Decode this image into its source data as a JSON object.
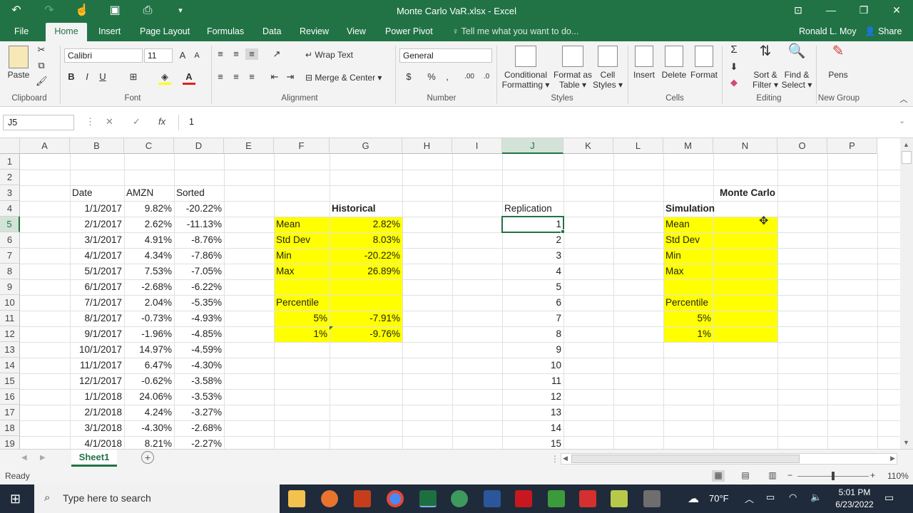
{
  "window": {
    "title": "Monte Carlo VaR.xlsx - Excel"
  },
  "tabs": [
    "File",
    "Home",
    "Insert",
    "Page Layout",
    "Formulas",
    "Data",
    "Review",
    "View",
    "Power Pivot"
  ],
  "tell_me": "Tell me what you want to do...",
  "user": "Ronald L. Moy",
  "share": "Share",
  "ribbon": {
    "paste": "Paste",
    "font_name": "Calibri",
    "font_size": "11",
    "wrap_text": "Wrap Text",
    "merge_center": "Merge & Center",
    "number_format": "General",
    "conditional_formatting": [
      "Conditional",
      "Formatting"
    ],
    "format_as_table": [
      "Format as",
      "Table"
    ],
    "cell_styles": [
      "Cell",
      "Styles"
    ],
    "insert": "Insert",
    "delete": "Delete",
    "format": "Format",
    "sort_filter": [
      "Sort &",
      "Filter"
    ],
    "find_select": [
      "Find &",
      "Select"
    ],
    "pens": "Pens",
    "groups": [
      "Clipboard",
      "Font",
      "Alignment",
      "Number",
      "Styles",
      "Cells",
      "Editing",
      "New Group"
    ]
  },
  "formula_bar": {
    "name_box": "J5",
    "value": "1"
  },
  "columns": [
    "A",
    "B",
    "C",
    "D",
    "E",
    "F",
    "G",
    "H",
    "I",
    "J",
    "K",
    "L",
    "M",
    "N",
    "O",
    "P"
  ],
  "rows": [
    "1",
    "2",
    "3",
    "4",
    "5",
    "6",
    "7",
    "8",
    "9",
    "10",
    "11",
    "12",
    "13",
    "14",
    "15",
    "16",
    "17",
    "18",
    "19"
  ],
  "data": {
    "headers": {
      "date": "Date",
      "amzn": "AMZN",
      "sorted": "Sorted"
    },
    "dates": [
      "1/1/2017",
      "2/1/2017",
      "3/1/2017",
      "4/1/2017",
      "5/1/2017",
      "6/1/2017",
      "7/1/2017",
      "8/1/2017",
      "9/1/2017",
      "10/1/2017",
      "11/1/2017",
      "12/1/2017",
      "1/1/2018",
      "2/1/2018",
      "3/1/2018",
      "4/1/2018"
    ],
    "amzn": [
      "9.82%",
      "2.62%",
      "4.91%",
      "4.34%",
      "7.53%",
      "-2.68%",
      "2.04%",
      "-0.73%",
      "-1.96%",
      "14.97%",
      "6.47%",
      "-0.62%",
      "24.06%",
      "4.24%",
      "-4.30%",
      "8.21%"
    ],
    "sorted": [
      "-20.22%",
      "-11.13%",
      "-8.76%",
      "-7.86%",
      "-7.05%",
      "-6.22%",
      "-5.35%",
      "-4.93%",
      "-4.85%",
      "-4.59%",
      "-4.30%",
      "-3.58%",
      "-3.53%",
      "-3.27%",
      "-2.68%",
      "-2.27%"
    ]
  },
  "historical": {
    "title": "Historical",
    "labels": [
      "Mean",
      "Std Dev",
      "Min",
      "Max"
    ],
    "values": [
      "2.82%",
      "8.03%",
      "-20.22%",
      "26.89%"
    ],
    "percentile_label": "Percentile",
    "percentiles": [
      "5%",
      "1%"
    ],
    "percentile_values": [
      "-7.91%",
      "-9.76%"
    ]
  },
  "replication": {
    "header": "Replication",
    "values": [
      "1",
      "2",
      "3",
      "4",
      "5",
      "6",
      "7",
      "8",
      "9",
      "10",
      "11",
      "12",
      "13",
      "14",
      "15"
    ]
  },
  "monte_carlo": {
    "title1": "Monte Carlo",
    "title2": "Simulation",
    "labels": [
      "Mean",
      "Std Dev",
      "Min",
      "Max"
    ],
    "percentile_label": "Percentile",
    "percentiles": [
      "5%",
      "1%"
    ]
  },
  "sheet_tab": "Sheet1",
  "status": {
    "ready": "Ready",
    "zoom": "110%"
  },
  "taskbar": {
    "search": "Type here to search",
    "temp": "70°F",
    "time": "5:01 PM",
    "date": "6/23/2022"
  }
}
